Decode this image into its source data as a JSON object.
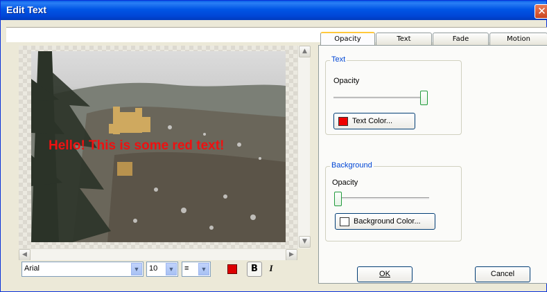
{
  "window": {
    "title": "Edit Text",
    "close_glyph": "✕"
  },
  "tabs": [
    {
      "label": "Opacity",
      "active": true
    },
    {
      "label": "Text",
      "active": false
    },
    {
      "label": "Fade",
      "active": false
    },
    {
      "label": "Motion",
      "active": false
    }
  ],
  "text_group": {
    "title": "Text",
    "opacity_label": "Opacity",
    "opacity_value": 1.0,
    "color_button": "Text Color...",
    "color_swatch": "#ee0000"
  },
  "background_group": {
    "title": "Background",
    "opacity_label": "Opacity",
    "opacity_value": 0.0,
    "color_button": "Background Color...",
    "color_swatch": "#ffffff"
  },
  "preview": {
    "overlay_text": "Hello! This is some red text!",
    "overlay_color": "#ee1111"
  },
  "toolbar": {
    "font_name": "Arial",
    "font_size": "10",
    "align_glyph": "≡",
    "color_swatch": "#dd0000",
    "bold_glyph": "B",
    "italic_glyph": "I"
  },
  "buttons": {
    "ok": "OK",
    "cancel": "Cancel"
  },
  "icons": {
    "scroll_up": "▲",
    "scroll_down": "▼",
    "scroll_left": "◀",
    "scroll_right": "▶",
    "dropdown": "▼"
  }
}
